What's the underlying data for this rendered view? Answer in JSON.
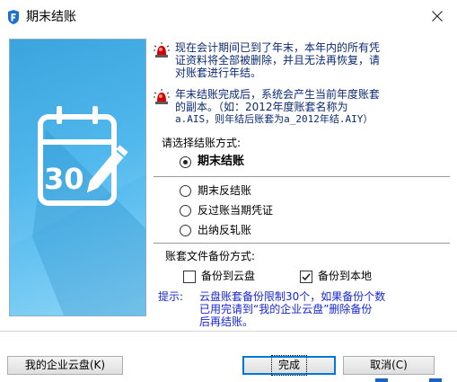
{
  "window": {
    "title": "期末结账",
    "close_glyph": "✕",
    "app_icon": "app-logo-icon"
  },
  "illustration": {
    "icon": "calendar-edit-icon",
    "day": "30"
  },
  "messages": [
    {
      "icon": "red-alert-light-icon",
      "lines": [
        "现在会计期间已到了年末，本年内的所有凭",
        "证资料将全部被删除，并且无法再恢复，请",
        "对账套进行年结。"
      ]
    },
    {
      "icon": "red-alert-light-icon",
      "lines": [
        "年末结账完成后，系统会产生当前年度账套",
        "的副本。（如：2012年度账套名称为",
        "a.AIS，则年结后账套为a_2012年结.AIY）"
      ]
    }
  ],
  "mode_label": "请选择结账方式:",
  "modes": [
    {
      "label": "期末结账",
      "selected": true
    },
    {
      "label": "期末反结账",
      "selected": false
    },
    {
      "label": "反过账当期凭证",
      "selected": false
    },
    {
      "label": "出纳反轧账",
      "selected": false
    }
  ],
  "backup_label": "账套文件备份方式:",
  "backups": [
    {
      "label": "备份到云盘",
      "checked": false
    },
    {
      "label": "备份到本地",
      "checked": true
    }
  ],
  "tip": {
    "label": "提示:",
    "lines": [
      "云盘账套备份限制30个，如果备份个数",
      "已用完请到“我的企业云盘”删除备份",
      "后再结账。"
    ]
  },
  "buttons": {
    "cloud": "我的企业云盘(K)",
    "ok": "完成",
    "cancel": "取消(C)"
  },
  "colors": {
    "message_text": "#0b2b73",
    "tip_text": "#1626d8",
    "panel": "#3aa9e4",
    "default_button_border": "#0078d7"
  }
}
